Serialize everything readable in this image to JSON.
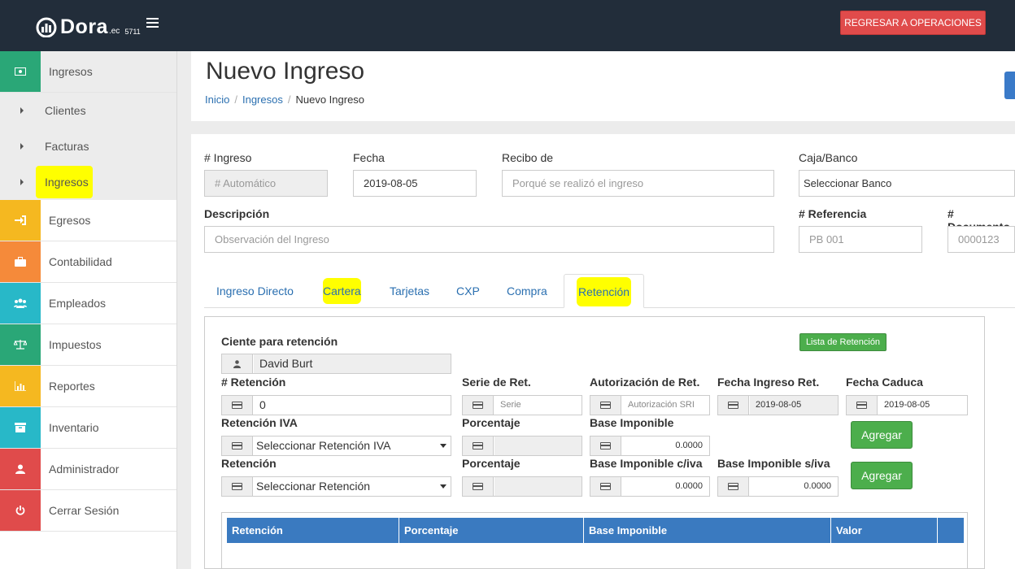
{
  "topbar": {
    "logo_text": "Dora",
    "logo_suffix": ".ec",
    "logo_number": "5711",
    "return_button": "REGRESAR A OPERACIONES"
  },
  "sidebar": {
    "items": [
      {
        "label": "Ingresos",
        "icon": "money-icon",
        "color": "#2aa777"
      },
      {
        "label": "Egresos",
        "icon": "sign-in-icon",
        "color": "#f5b820"
      },
      {
        "label": "Contabilidad",
        "icon": "briefcase-icon",
        "color": "#f58a3a"
      },
      {
        "label": "Empleados",
        "icon": "users-icon",
        "color": "#28b8c8"
      },
      {
        "label": "Impuestos",
        "icon": "balance-scale-icon",
        "color": "#2aa777"
      },
      {
        "label": "Reportes",
        "icon": "bar-chart-icon",
        "color": "#f5b820"
      },
      {
        "label": "Inventario",
        "icon": "archive-icon",
        "color": "#28b8c8"
      },
      {
        "label": "Administrador",
        "icon": "user-icon",
        "color": "#e04b4b"
      },
      {
        "label": "Cerrar Sesión",
        "icon": "power-icon",
        "color": "#e04b4b"
      }
    ],
    "subitems": [
      "Clientes",
      "Facturas",
      "Ingresos"
    ]
  },
  "header": {
    "title": "Nuevo Ingreso",
    "breadcrumb": [
      "Inicio",
      "Ingresos",
      "Nuevo Ingreso"
    ]
  },
  "form": {
    "ingreso_label": "# Ingreso",
    "ingreso_placeholder": "# Automático",
    "fecha_label": "Fecha",
    "fecha_value": "2019-08-05",
    "recibo_label": "Recibo de",
    "recibo_placeholder": "Porqué se realizó el ingreso",
    "caja_label": "Caja/Banco",
    "caja_value": "Seleccionar Banco",
    "descripcion_label": "Descripción",
    "descripcion_placeholder": "Observación del Ingreso",
    "referencia_label": "# Referencia",
    "referencia_placeholder": "PB 001",
    "documento_label": "# Documento",
    "documento_placeholder": "0000123"
  },
  "tabs": [
    "Ingreso Directo",
    "Cartera",
    "Tarjetas",
    "CXP",
    "Compra",
    "Retención"
  ],
  "retencion": {
    "cliente_label": "Ciente para retención",
    "cliente_value": "David Burt",
    "lista_button": "Lista de Retención",
    "num_label": "# Retención",
    "num_value": "0",
    "serie_label": "Serie de Ret.",
    "serie_placeholder": "Serie",
    "autorizacion_label": "Autorización de Ret.",
    "autorizacion_placeholder": "Autorización SRI",
    "fecha_ingreso_label": "Fecha Ingreso Ret.",
    "fecha_ingreso_value": "2019-08-05",
    "fecha_caduca_label": "Fecha Caduca",
    "fecha_caduca_value": "2019-08-05",
    "iva_label": "Retención IVA",
    "iva_value": "Seleccionar Retención IVA",
    "porcentaje_label": "Porcentaje",
    "base_label": "Base Imponible",
    "base_value": "0.0000",
    "agregar_1": "Agregar",
    "ret_label": "Retención",
    "ret_value": "Seleccionar Retención",
    "porcentaje2_label": "Porcentaje",
    "base_civa_label": "Base Imponible c/iva",
    "base_civa_value": "0.0000",
    "base_siva_label": "Base Imponible s/iva",
    "base_siva_value": "0.0000",
    "agregar_2": "Agregar"
  },
  "table": {
    "columns": [
      "Retención",
      "Porcentaje",
      "Base Imponible",
      "Valor"
    ]
  }
}
